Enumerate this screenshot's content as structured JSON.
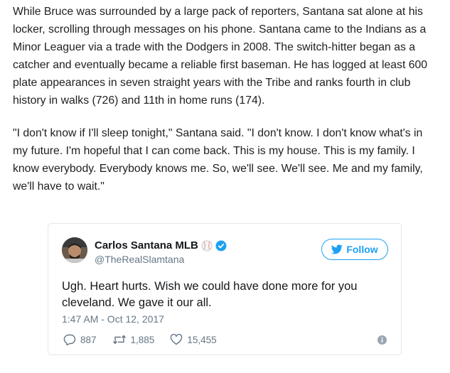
{
  "article": {
    "paragraphs": [
      "While Bruce was surrounded by a large pack of reporters, Santana sat alone at his locker, scrolling through messages on his phone. Santana came to the Indians as a Minor Leaguer via a trade with the Dodgers in 2008. The switch-hitter began as a catcher and eventually became a reliable first baseman. He has logged at least 600 plate appearances in seven straight years with the Tribe and ranks fourth in club history in walks (726) and 11th in home runs (174).",
      "\"I don't know if I'll sleep tonight,\" Santana said. \"I don't know. I don't know what's in my future. I'm hopeful that I can come back. This is my house. This is my family. I know everybody. Everybody knows me. So, we'll see. We'll see. Me and my family, we'll have to wait.\""
    ]
  },
  "tweet": {
    "display_name": "Carlos Santana MLB",
    "handle": "@TheRealSlamtana",
    "follow_label": "Follow",
    "text": "Ugh. Heart hurts. Wish we could have done more for you cleveland. We gave it our all.",
    "timestamp": "1:47 AM - Oct 12, 2017",
    "replies": "887",
    "retweets": "1,885",
    "likes": "15,455",
    "icons": {
      "avatar": "avatar-photo",
      "name_emoji": "baseball-icon",
      "verified": "verified-badge-icon",
      "follow": "twitter-bird-icon",
      "reply": "reply-icon",
      "retweet": "retweet-icon",
      "like": "heart-icon",
      "info": "info-icon"
    },
    "colors": {
      "twitter_blue": "#1da1f2",
      "secondary_text": "#657786",
      "border": "#e1e8ed"
    }
  }
}
